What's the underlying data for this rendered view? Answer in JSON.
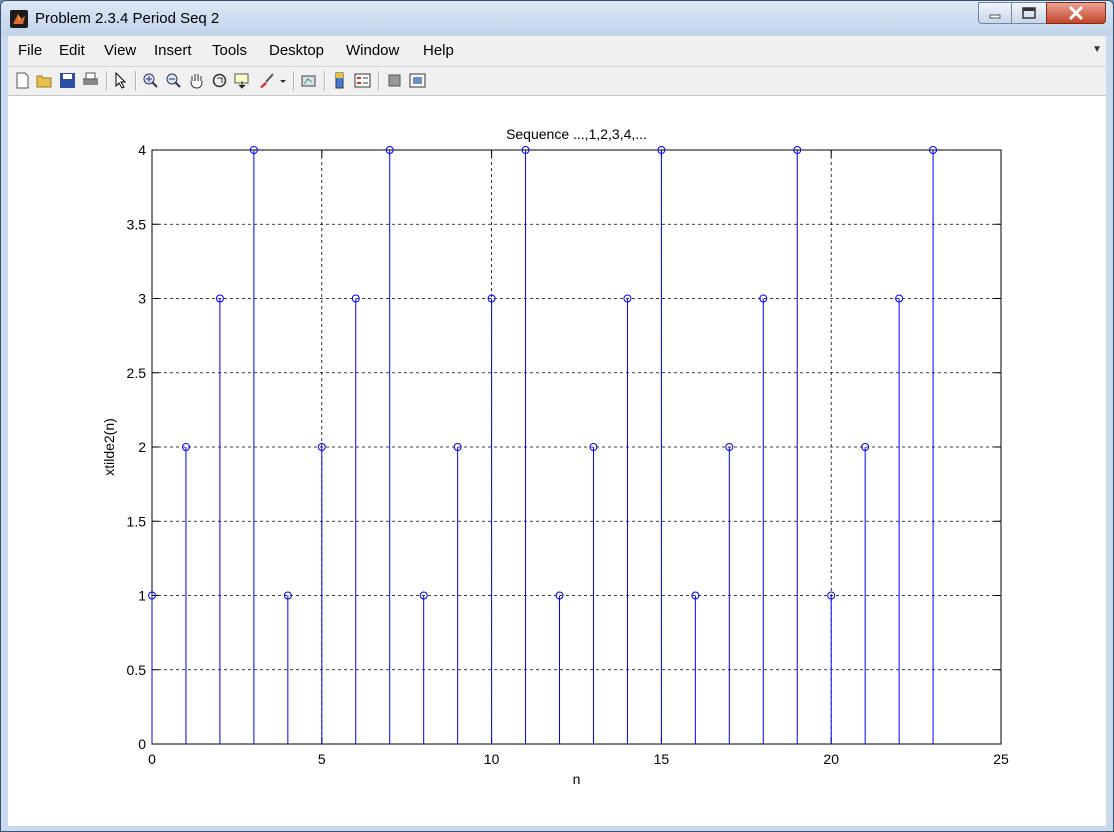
{
  "window": {
    "title": "Problem 2.3.4 Period Seq 2"
  },
  "menu": [
    "File",
    "Edit",
    "View",
    "Insert",
    "Tools",
    "Desktop",
    "Window",
    "Help"
  ],
  "toolbar_icons": [
    "new-file-icon",
    "open-folder-icon",
    "save-icon",
    "print-icon",
    "pointer-icon",
    "zoom-in-icon",
    "zoom-out-icon",
    "pan-hand-icon",
    "rotate-3d-icon",
    "data-cursor-icon",
    "brush-icon",
    "dropdown-arrow-icon",
    "link-plot-icon",
    "colorbar-icon",
    "legend-icon",
    "hide-plot-tools-icon",
    "show-plot-tools-icon"
  ],
  "colors": {
    "stem": "#0000ff",
    "grid": "#000000",
    "axes_bg": "#ffffff",
    "figure_bg": "#ffffff"
  },
  "chart_data": {
    "type": "stem",
    "title": "Sequence ...,1,2,3,4,...",
    "xlabel": "n",
    "ylabel": "xtilde2(n)",
    "xlim": [
      0,
      25
    ],
    "ylim": [
      0,
      4
    ],
    "xticks": [
      0,
      5,
      10,
      15,
      20,
      25
    ],
    "yticks": [
      0,
      0.5,
      1,
      1.5,
      2,
      2.5,
      3,
      3.5,
      4
    ],
    "grid": true,
    "x": [
      0,
      1,
      2,
      3,
      4,
      5,
      6,
      7,
      8,
      9,
      10,
      11,
      12,
      13,
      14,
      15,
      16,
      17,
      18,
      19,
      20,
      21,
      22,
      23
    ],
    "y": [
      1,
      2,
      3,
      4,
      1,
      2,
      3,
      4,
      1,
      2,
      3,
      4,
      1,
      2,
      3,
      4,
      1,
      2,
      3,
      4,
      1,
      2,
      3,
      4
    ]
  }
}
